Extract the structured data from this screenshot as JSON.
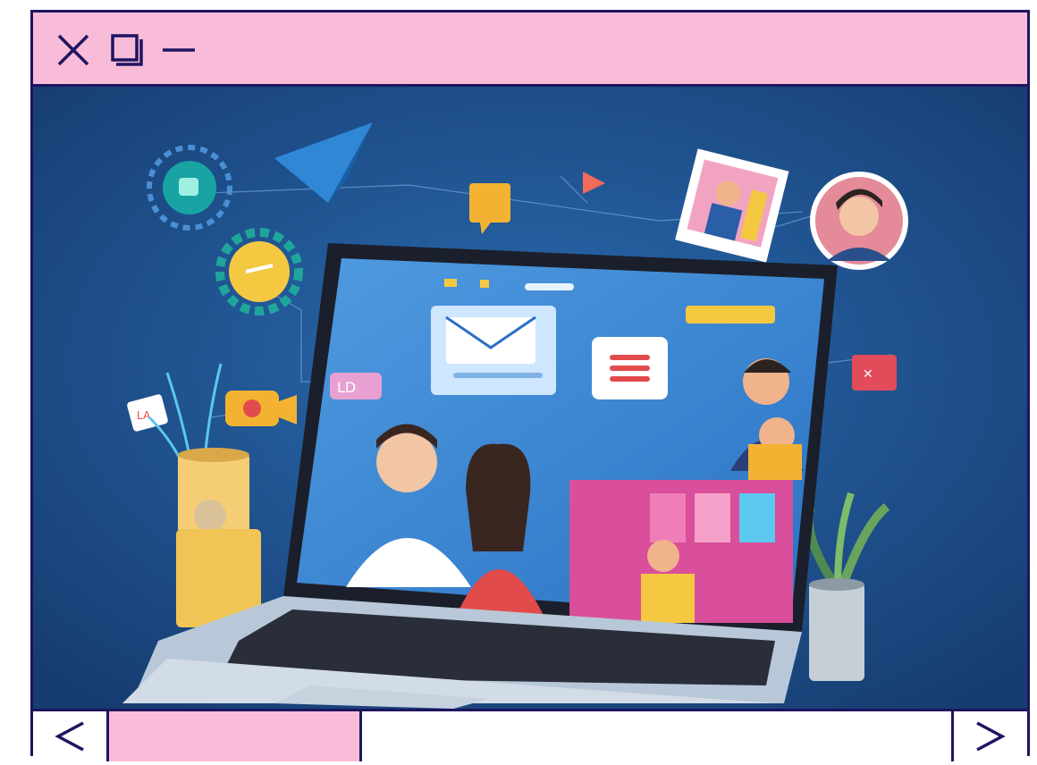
{
  "window": {
    "controls": [
      {
        "name": "close",
        "icon": "close-icon"
      },
      {
        "name": "maximize",
        "icon": "restore-window-icon"
      },
      {
        "name": "minimize",
        "icon": "minimize-icon"
      }
    ]
  },
  "image": {
    "icon": "laptop-video-call-illustration",
    "chat_bubble_label": "LD"
  },
  "footer": {
    "prev_glyph": "<",
    "next_glyph": ">",
    "progress_fraction": 0.3
  },
  "colors": {
    "frame": "#1e1560",
    "accent_pink": "#f8bcd8",
    "scene_bg": "#1c4d8a"
  }
}
